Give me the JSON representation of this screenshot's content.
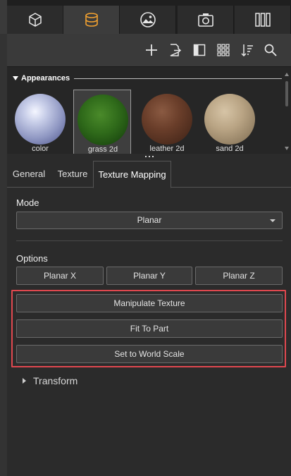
{
  "category_tabs": [
    {
      "name": "bodies",
      "icon": "cube-icon"
    },
    {
      "name": "appearances",
      "icon": "cylinder-icon",
      "active": true
    },
    {
      "name": "environment",
      "icon": "landscape-icon"
    },
    {
      "name": "render",
      "icon": "camera-icon"
    },
    {
      "name": "library",
      "icon": "books-icon"
    }
  ],
  "toolbar": {
    "icons": [
      "plus-icon",
      "export-icon",
      "panel-icon",
      "grid-icon",
      "sort-icon",
      "search-icon"
    ]
  },
  "appearances": {
    "title": "Appearances",
    "items": [
      {
        "label": "color",
        "selected": false
      },
      {
        "label": "grass 2d",
        "selected": true
      },
      {
        "label": "leather 2d",
        "selected": false
      },
      {
        "label": "sand 2d",
        "selected": false
      }
    ]
  },
  "subtabs": {
    "general": "General",
    "texture": "Texture",
    "texture_mapping": "Texture Mapping",
    "active": "Texture Mapping"
  },
  "mode": {
    "label": "Mode",
    "selected": "Planar"
  },
  "options": {
    "label": "Options",
    "planar_x": "Planar X",
    "planar_y": "Planar Y",
    "planar_z": "Planar Z"
  },
  "actions": {
    "manipulate": "Manipulate Texture",
    "fit": "Fit To Part",
    "world_scale": "Set to World Scale"
  },
  "transform": {
    "label": "Transform"
  },
  "colors": {
    "highlight": "#e0484f",
    "accent": "#f0a030"
  }
}
